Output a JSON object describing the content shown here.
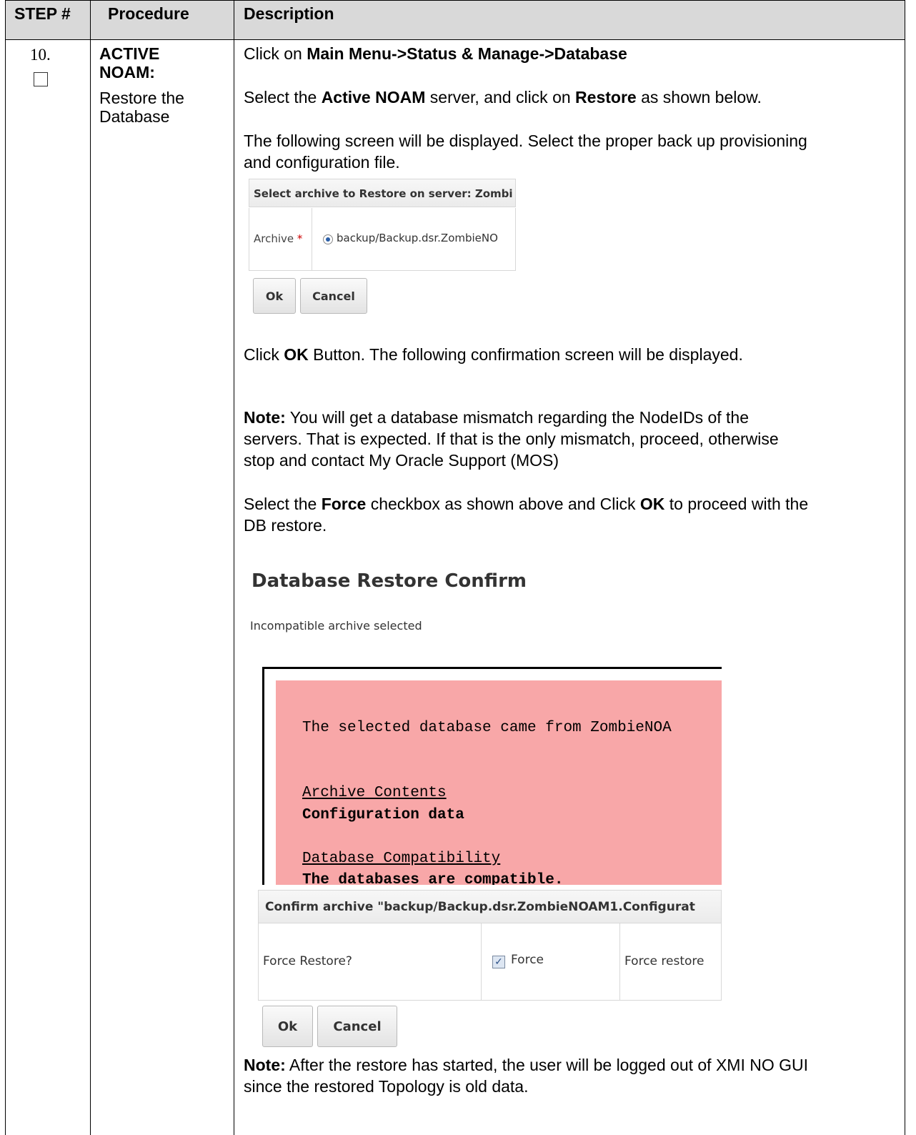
{
  "header": {
    "step": "STEP #",
    "procedure": "Procedure",
    "description": "Description"
  },
  "step": {
    "number": "10.",
    "checkbox_icon": "empty-checkbox",
    "procedure_line1": "ACTIVE",
    "procedure_line2": "NOAM:",
    "procedure_line3": "Restore the",
    "procedure_line4": "Database"
  },
  "desc": {
    "p1_text": "Click on ",
    "p1_bold": "Main Menu->Status & Manage->Database",
    "p2_a": "Select the ",
    "p2_b": "Active NOAM",
    "p2_c": " server, and click on ",
    "p2_d": "Restore",
    "p2_e": " as shown below.",
    "p3_line1": "The following screen will be displayed. Select the proper back up provisioning",
    "p3_line2": "and configuration file.",
    "p4_a": "Click ",
    "p4_b": "OK",
    "p4_c": " Button. The following confirmation screen will be displayed.",
    "note1_label": "Note:",
    "note1_line1": " You will get a database mismatch regarding the NodeIDs of the",
    "note1_line2": "servers. That is expected. If that is the only mismatch, proceed, otherwise",
    "note1_line3": "stop and contact My Oracle Support (MOS)",
    "p5_a": "Select the ",
    "p5_b": "Force",
    "p5_c": " checkbox as shown above and Click ",
    "p5_d": "OK",
    "p5_e": " to proceed with the",
    "p5_line2": "DB restore.",
    "note2_label": "Note:",
    "note2_line1": " After the restore has started, the user will be logged out of XMI NO GUI",
    "note2_line2": "since the restored Topology is old data."
  },
  "restore_dialog": {
    "title": "Select archive to Restore on server: Zombi",
    "archive_label": "Archive",
    "required_mark": "*",
    "archive_value": "backup/Backup.dsr.ZombieNO",
    "ok": "Ok",
    "cancel": "Cancel"
  },
  "confirm": {
    "title": "Database Restore Confirm",
    "subtitle": "Incompatible archive selected",
    "mono_line1": "The selected database came from ZombieNOA",
    "archive_contents_label": "Archive Contents",
    "archive_contents_value": "Configuration data",
    "compat_label": "Database Compatibility",
    "compat_value": "The databases are compatible.",
    "confirm_title": "Confirm archive \"backup/Backup.dsr.ZombieNOAM1.Configurat",
    "force_label": "Force Restore?",
    "force_checkbox_mark": "✓",
    "force_checkbox_text": "Force",
    "force_desc": "Force restore",
    "ok": "Ok",
    "cancel": "Cancel"
  }
}
